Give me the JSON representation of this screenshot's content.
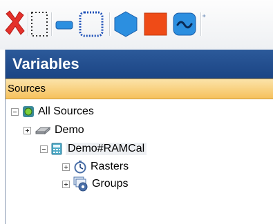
{
  "toolbar": {
    "buttons": [
      {
        "icon": "red-x-icon"
      },
      {
        "icon": "dotted-rectangle-select-icon"
      },
      {
        "icon": "blue-rounded-bar-icon"
      },
      {
        "icon": "dotted-blue-rounded-square-icon"
      },
      {
        "icon": "blue-hexagon-icon"
      },
      {
        "icon": "orange-square-icon"
      },
      {
        "icon": "blue-wave-icon"
      }
    ]
  },
  "panel": {
    "title": "Variables",
    "sources_label": "Sources"
  },
  "tree": {
    "root": {
      "label": "All Sources",
      "icon": "source-cube-icon",
      "expanded": true
    },
    "children": [
      {
        "label": "Demo",
        "icon": "device-icon",
        "expanded": false
      },
      {
        "label": "Demo#RAMCal",
        "icon": "calculator-icon",
        "expanded": true,
        "children": [
          {
            "label": "Rasters",
            "icon": "stopwatch-icon",
            "expanded": false
          },
          {
            "label": "Groups",
            "icon": "groups-icon",
            "expanded": false
          }
        ]
      }
    ]
  },
  "colors": {
    "header_blue": "#1f4a8a",
    "sources_orange": "#f6c15c",
    "delete_red": "#e4312b"
  }
}
